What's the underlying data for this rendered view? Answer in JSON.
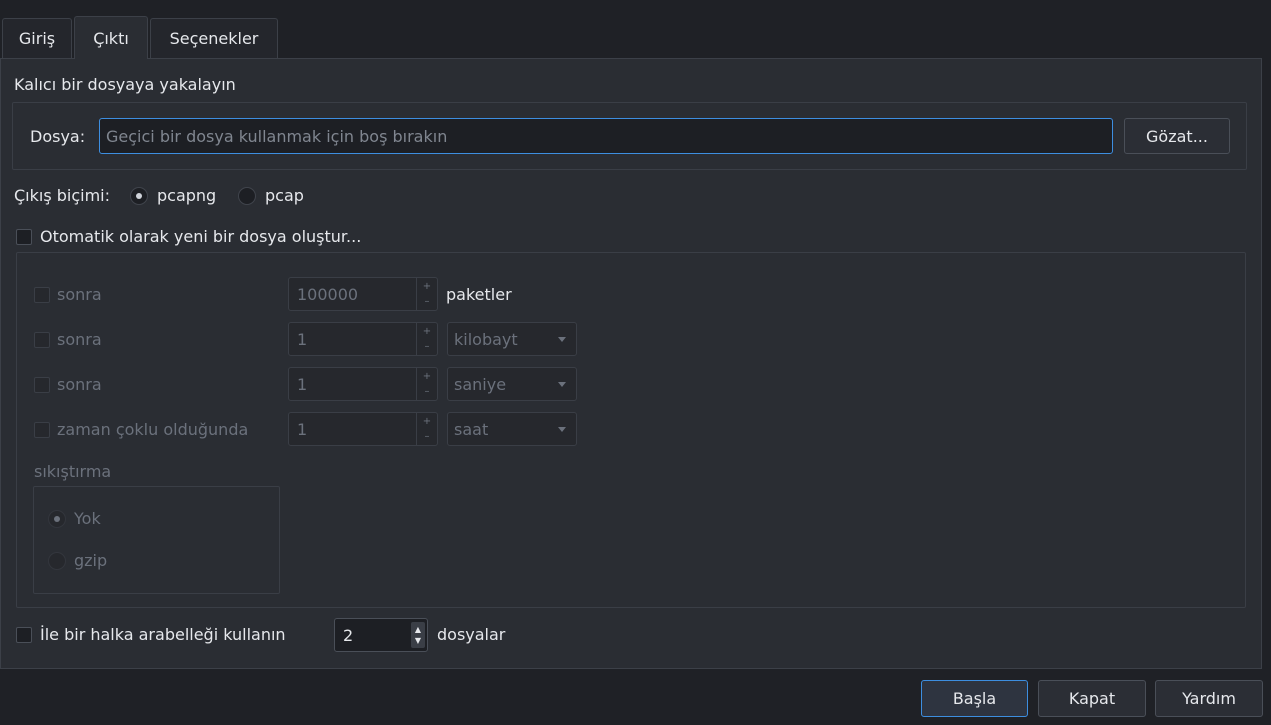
{
  "tabs": [
    {
      "label": "Giriş"
    },
    {
      "label": "Çıktı"
    },
    {
      "label": "Seçenekler"
    }
  ],
  "capture_file": {
    "heading": "Kalıcı bir dosyaya yakalayın",
    "file_label": "Dosya:",
    "file_placeholder": "Geçici bir dosya kullanmak için boş bırakın",
    "browse_label": "Gözat..."
  },
  "output_format": {
    "label": "Çıkış biçimi:",
    "options": [
      "pcapng",
      "pcap"
    ],
    "selected": "pcapng"
  },
  "auto_new_file": {
    "label": "Otomatik olarak yeni bir dosya oluştur...",
    "rows": [
      {
        "label": "sonra",
        "value": "100000",
        "unit": "paketler"
      },
      {
        "label": "sonra",
        "value": "1",
        "unit": "kilobayt"
      },
      {
        "label": "sonra",
        "value": "1",
        "unit": "saniye"
      },
      {
        "label": "zaman çoklu olduğunda",
        "value": "1",
        "unit": "saat"
      }
    ],
    "compression": {
      "label": "sıkıştırma",
      "options": [
        "Yok",
        "gzip"
      ],
      "selected": "Yok"
    }
  },
  "ring_buffer": {
    "label": "İle bir halka arabelleği kullanın",
    "value": "2",
    "unit": "dosyalar"
  },
  "buttons": {
    "start": "Başla",
    "close": "Kapat",
    "help": "Yardım"
  },
  "colors": {
    "background": "#1f2126",
    "panel": "#2a2d33",
    "accent": "#3d8ee0"
  }
}
